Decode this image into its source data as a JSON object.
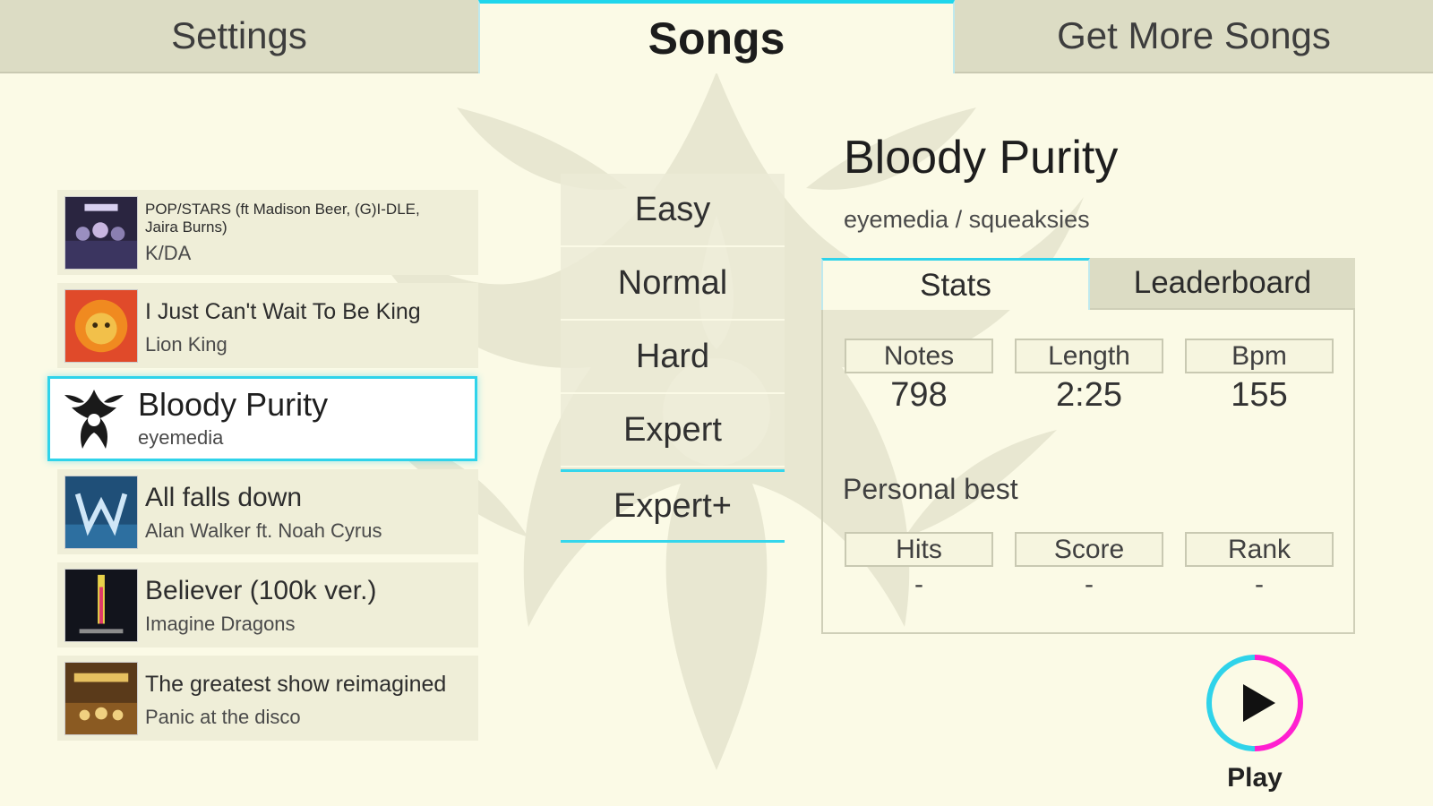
{
  "tabs": [
    {
      "label": "Settings"
    },
    {
      "label": "Songs"
    },
    {
      "label": "Get More Songs"
    }
  ],
  "songs": [
    {
      "title": "POP/STARS (ft Madison Beer, (G)I-DLE, Jaira Burns)",
      "artist": "K/DA"
    },
    {
      "title": "I Just Can't Wait To Be King",
      "artist": "Lion King"
    },
    {
      "title": "Bloody Purity",
      "artist": "eyemedia"
    },
    {
      "title": "All falls down",
      "artist": "Alan Walker ft. Noah Cyrus"
    },
    {
      "title": "Believer (100k ver.)",
      "artist": "Imagine Dragons"
    },
    {
      "title": "The greatest show reimagined",
      "artist": "Panic at the disco"
    }
  ],
  "difficulties": [
    {
      "label": "Easy"
    },
    {
      "label": "Normal"
    },
    {
      "label": "Hard"
    },
    {
      "label": "Expert"
    },
    {
      "label": "Expert+"
    }
  ],
  "selected_difficulty": "Expert+",
  "detail": {
    "title": "Bloody Purity",
    "subtitle": "eyemedia / squeaksies",
    "tabs": [
      {
        "label": "Stats"
      },
      {
        "label": "Leaderboard"
      }
    ],
    "stats": [
      {
        "label": "Notes",
        "value": "798"
      },
      {
        "label": "Length",
        "value": "2:25"
      },
      {
        "label": "Bpm",
        "value": "155"
      }
    ],
    "personal_best_label": "Personal best",
    "personal_best": [
      {
        "label": "Hits",
        "value": "-"
      },
      {
        "label": "Score",
        "value": "-"
      },
      {
        "label": "Rank",
        "value": "-"
      }
    ]
  },
  "play": {
    "label": "Play",
    "icon": "play-icon"
  },
  "colors": {
    "accent_cyan": "#2fd3ea",
    "accent_magenta": "#ff1fd0",
    "background": "#fbfae6"
  }
}
